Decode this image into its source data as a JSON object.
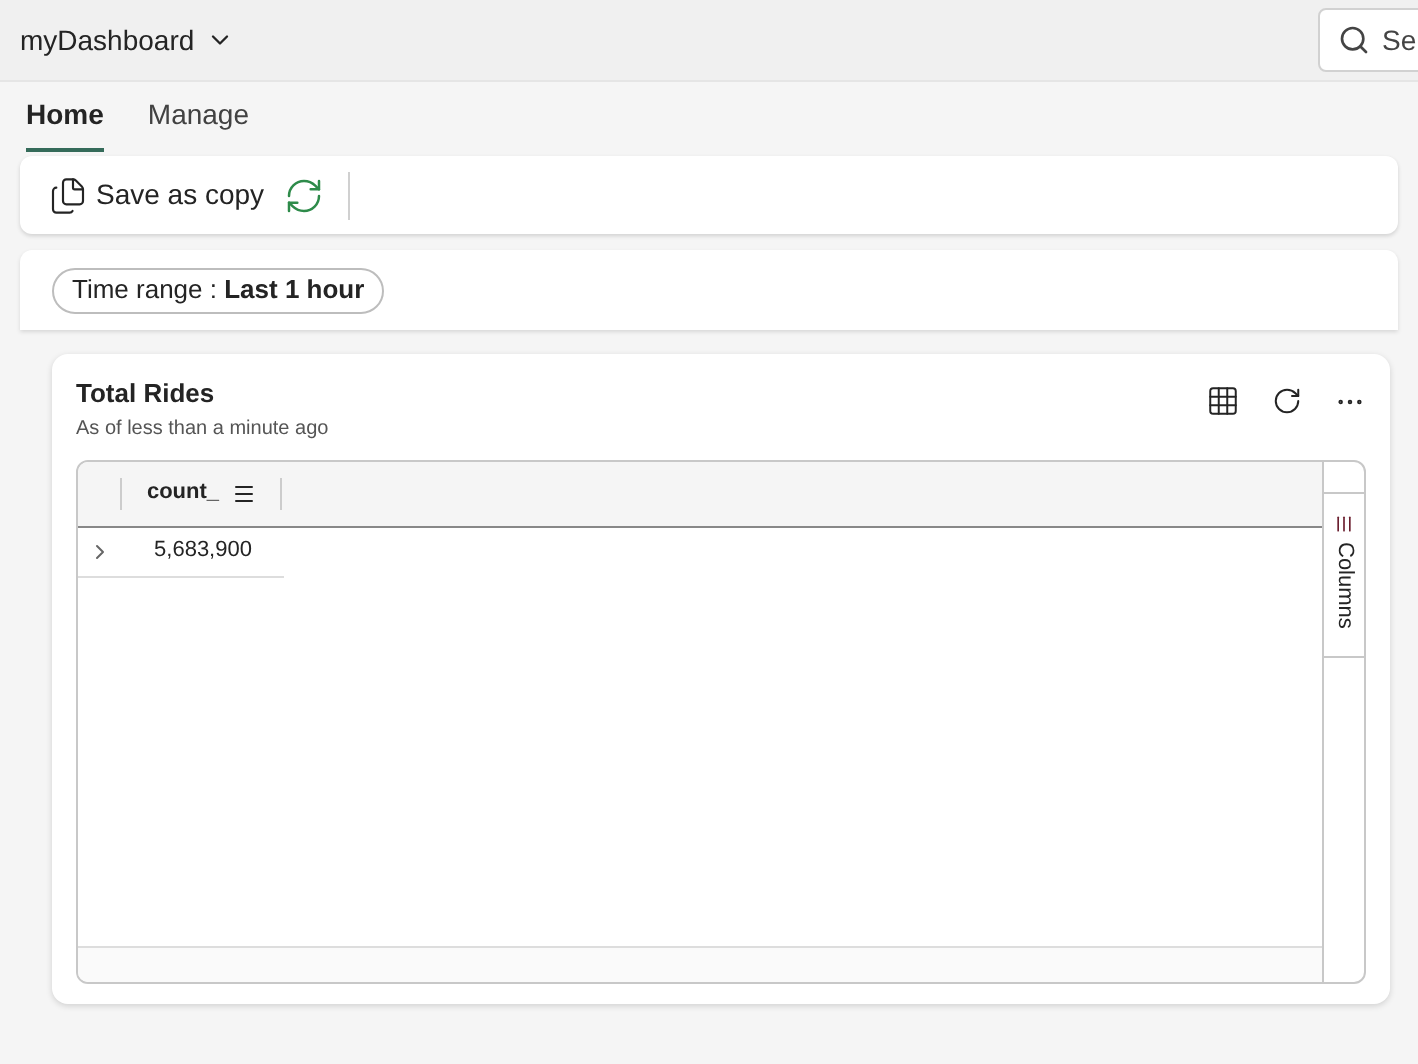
{
  "header": {
    "title": "myDashboard",
    "search": {
      "placeholder": "Se"
    }
  },
  "tabs": [
    {
      "label": "Home",
      "selected": true
    },
    {
      "label": "Manage",
      "selected": false
    }
  ],
  "toolbar": {
    "save_label": "Save as copy"
  },
  "filter": {
    "label": "Time range : **Last 1 hour**"
  },
  "tile": {
    "title": "Total Rides",
    "subtitle": "As of less than a minute ago",
    "table": {
      "columns": [
        "count_"
      ],
      "rows": [
        {
          "cells": [
            "5,683,900"
          ],
          "expanded": false
        }
      ]
    },
    "side_panel": "Columns"
  }
}
